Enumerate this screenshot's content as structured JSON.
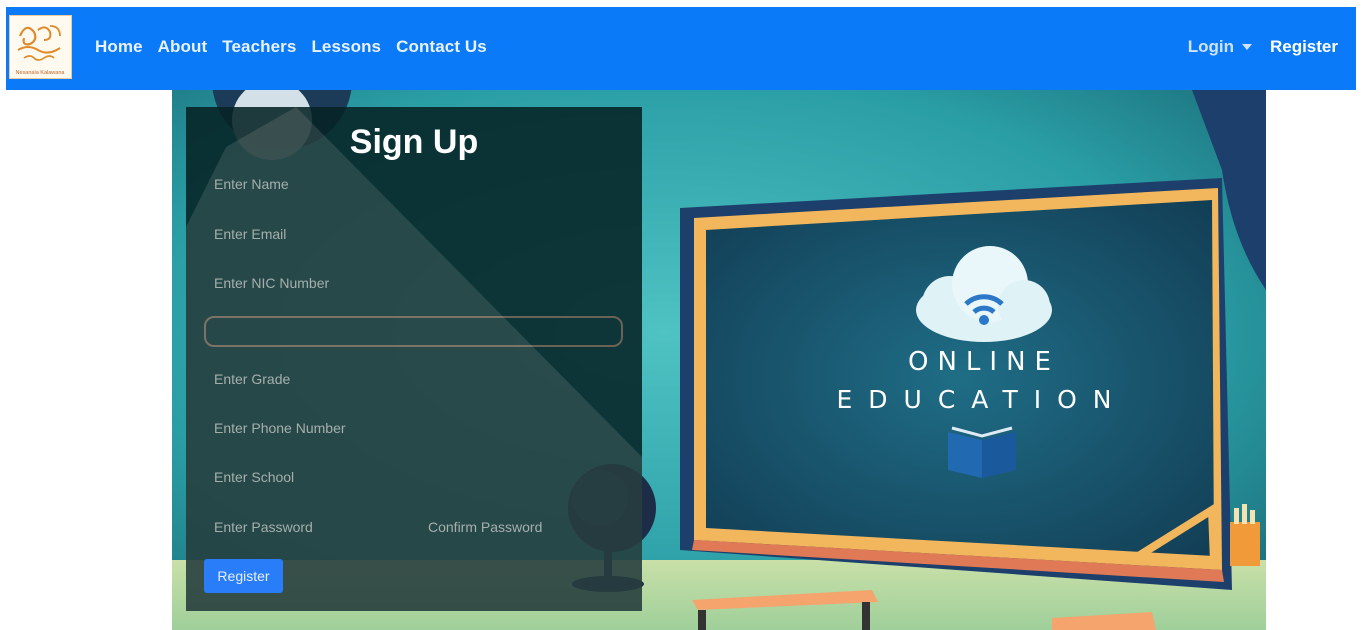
{
  "nav": {
    "logo_text": "Nesanala Kalawana",
    "links": [
      "Home",
      "About",
      "Teachers",
      "Lessons",
      "Contact Us"
    ],
    "login_label": "Login",
    "register_label": "Register"
  },
  "hero": {
    "line1": "ONLINE",
    "line2": "EDUCATION"
  },
  "form": {
    "title": "Sign Up",
    "name_placeholder": "Enter Name",
    "email_placeholder": "Enter Email",
    "nic_placeholder": "Enter NIC Number",
    "birthday_value": "",
    "grade_placeholder": "Enter Grade",
    "phone_placeholder": "Enter Phone Number",
    "school_placeholder": "Enter School",
    "password_placeholder": "Enter Password",
    "confirm_password_placeholder": "Confirm Password",
    "submit_label": "Register"
  },
  "colors": {
    "navbar": "#0a7af8",
    "panel": "#062224",
    "button": "#0d6efd"
  }
}
